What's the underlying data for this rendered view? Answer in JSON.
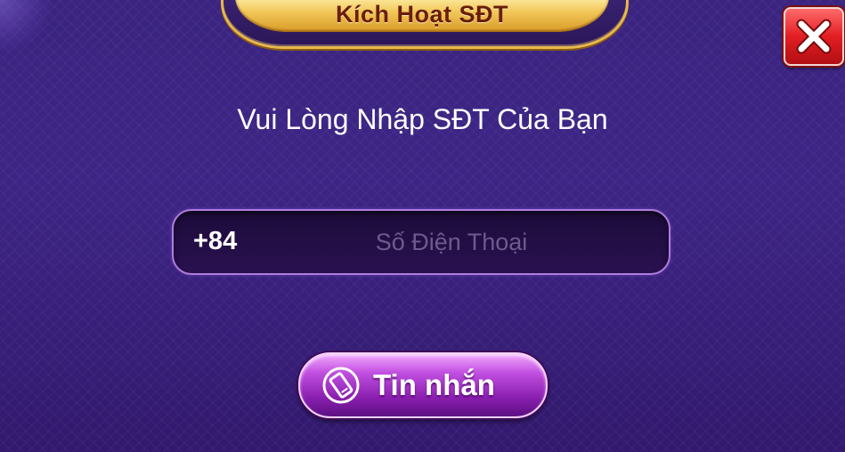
{
  "dialog": {
    "title": "Kích Hoạt SĐT",
    "prompt": "Vui Lòng Nhập SĐT Của Bạn",
    "close_icon": "close-x-icon"
  },
  "phone_field": {
    "prefix": "+84",
    "value": "",
    "placeholder": "Số Điện Thoại"
  },
  "sms_button": {
    "label": "Tin nhắn",
    "icon": "phone-icon"
  },
  "colors": {
    "background": "#3a2480",
    "title_gold": "#f2c85a",
    "title_text": "#6a1e0c",
    "close_red": "#e21e22",
    "button_purple": "#a12fcb",
    "field_border": "#b07ce0"
  }
}
